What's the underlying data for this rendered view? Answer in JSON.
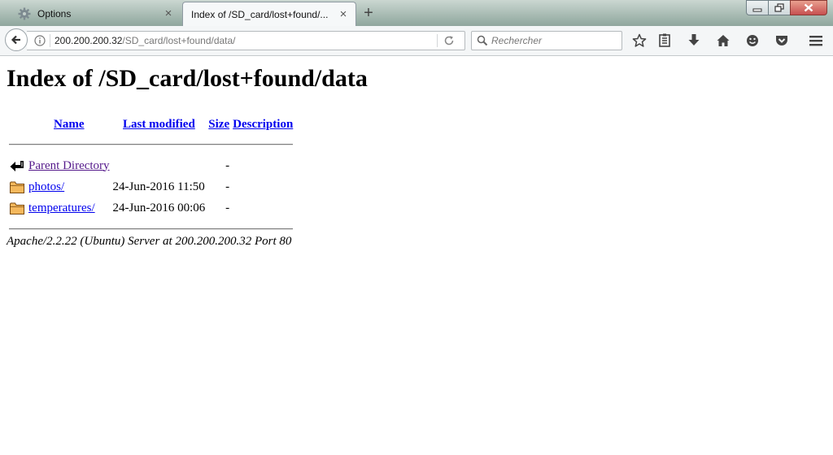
{
  "browser": {
    "tabs": [
      {
        "label": "Options",
        "active": false
      },
      {
        "label": "Index of /SD_card/lost+found/...",
        "active": true
      }
    ],
    "tab_close_glyph": "×",
    "new_tab_glyph": "+",
    "address": {
      "host": "200.200.200.32",
      "path": "/SD_card/lost+found/data/"
    },
    "search": {
      "placeholder": "Rechercher"
    },
    "toolbar_icons": [
      "star-icon",
      "reading-list-icon",
      "download-icon",
      "home-icon",
      "smiley-icon",
      "pocket-icon",
      "menu-icon"
    ],
    "colors": {
      "titlebar": "#a9bcb4",
      "close_button": "#c75050",
      "link": "#0000ee",
      "visited_link": "#551a8b"
    }
  },
  "page": {
    "title": "Index of /SD_card/lost+found/data",
    "columns": {
      "name": "Name",
      "last_modified": "Last modified",
      "size": "Size",
      "description": "Description"
    },
    "rows": [
      {
        "icon": "parent-directory-icon",
        "name": "Parent Directory",
        "modified": "",
        "size": "-",
        "description": ""
      },
      {
        "icon": "folder-icon",
        "name": "photos/",
        "modified": "24-Jun-2016 11:50",
        "size": "-",
        "description": ""
      },
      {
        "icon": "folder-icon",
        "name": "temperatures/",
        "modified": "24-Jun-2016 00:06",
        "size": "-",
        "description": ""
      }
    ],
    "footer": "Apache/2.2.22 (Ubuntu) Server at 200.200.200.32 Port 80"
  }
}
